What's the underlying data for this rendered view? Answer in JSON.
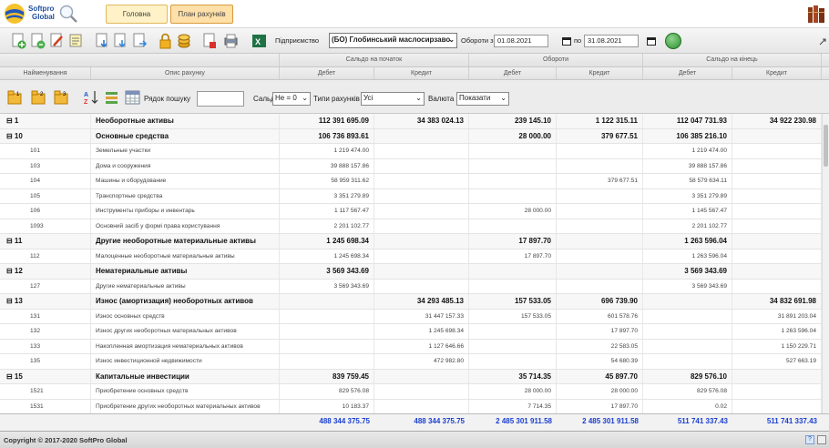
{
  "header": {
    "brand_line1": "Softpro",
    "brand_line2": "Global",
    "tabs": [
      {
        "label": "Головна"
      },
      {
        "label": "План рахунків"
      }
    ]
  },
  "toolbar": {
    "enterprise_label": "Підприємство",
    "enterprise_value": "(БО) Глобинський маслосирзаво",
    "turnover_from_label": "Обороти з",
    "date_from": "01.08.2021",
    "to_label": "по",
    "date_to": "31.08.2021"
  },
  "columns": {
    "group_opening": "Сальдо на початок",
    "group_turnover": "Обороти",
    "group_closing": "Сальдо на кінець",
    "name": "Найменування",
    "description": "Опис рахунку",
    "debit": "Дебет",
    "credit": "Кредит"
  },
  "filters": {
    "search_label": "Рядок пошуку",
    "saldo_label": "Сальдо",
    "saldo_value": "Не = 0",
    "types_label": "Типи рахунків",
    "types_value": "Усі",
    "currency_label": "Валюта",
    "currency_value": "Показати"
  },
  "rows": [
    {
      "code": "⊟ 1",
      "desc": "Необоротные активы",
      "d1": "112 391 695.09",
      "k1": "34 383 024.13",
      "d2": "239 145.10",
      "k2": "1 122 315.11",
      "d3": "112 047 731.93",
      "k3": "34 922 230.98",
      "grp": true
    },
    {
      "code": "⊟ 10",
      "desc": "Основные средства",
      "d1": "106 736 893.61",
      "k1": "",
      "d2": "28 000.00",
      "k2": "379 677.51",
      "d3": "106 385 216.10",
      "k3": "",
      "grp": true
    },
    {
      "code": "101",
      "desc": "Земельные участки",
      "d1": "1 219 474.00",
      "k1": "",
      "d2": "",
      "k2": "",
      "d3": "1 219 474.00",
      "k3": ""
    },
    {
      "code": "103",
      "desc": "Дома и сооружения",
      "d1": "39 888 157.86",
      "k1": "",
      "d2": "",
      "k2": "",
      "d3": "39 888 157.86",
      "k3": ""
    },
    {
      "code": "104",
      "desc": "Машины и оборудование",
      "d1": "58 959 311.62",
      "k1": "",
      "d2": "",
      "k2": "379 677.51",
      "d3": "58 579 634.11",
      "k3": ""
    },
    {
      "code": "105",
      "desc": "Транспортные средства",
      "d1": "3 351 279.89",
      "k1": "",
      "d2": "",
      "k2": "",
      "d3": "3 351 279.89",
      "k3": ""
    },
    {
      "code": "106",
      "desc": "Инструменты приборы и инвентарь",
      "d1": "1 117 567.47",
      "k1": "",
      "d2": "28 000.00",
      "k2": "",
      "d3": "1 145 567.47",
      "k3": ""
    },
    {
      "code": "1093",
      "desc": "Основний засіб у формі права користування",
      "d1": "2 201 102.77",
      "k1": "",
      "d2": "",
      "k2": "",
      "d3": "2 201 102.77",
      "k3": ""
    },
    {
      "code": "⊟ 11",
      "desc": "Другие необоротные материальные активы",
      "d1": "1 245 698.34",
      "k1": "",
      "d2": "17 897.70",
      "k2": "",
      "d3": "1 263 596.04",
      "k3": "",
      "grp": true
    },
    {
      "code": "112",
      "desc": "Малоценные необоротные материальные активы",
      "d1": "1 245 698.34",
      "k1": "",
      "d2": "17 897.70",
      "k2": "",
      "d3": "1 263 596.04",
      "k3": ""
    },
    {
      "code": "⊟ 12",
      "desc": "Нематериальные активы",
      "d1": "3 569 343.69",
      "k1": "",
      "d2": "",
      "k2": "",
      "d3": "3 569 343.69",
      "k3": "",
      "grp": true
    },
    {
      "code": "127",
      "desc": "Другие нематериальные активы",
      "d1": "3 569 343.69",
      "k1": "",
      "d2": "",
      "k2": "",
      "d3": "3 569 343.69",
      "k3": ""
    },
    {
      "code": "⊟ 13",
      "desc": "Износ (амортизация) необоротных активов",
      "d1": "",
      "k1": "34 293 485.13",
      "d2": "157 533.05",
      "k2": "696 739.90",
      "d3": "",
      "k3": "34 832 691.98",
      "grp": true
    },
    {
      "code": "131",
      "desc": "Износ основных средств",
      "d1": "",
      "k1": "31 447 157.33",
      "d2": "157 533.05",
      "k2": "601 578.76",
      "d3": "",
      "k3": "31 891 203.04"
    },
    {
      "code": "132",
      "desc": "Износ других необоротных материальных активов",
      "d1": "",
      "k1": "1 245 698.34",
      "d2": "",
      "k2": "17 897.70",
      "d3": "",
      "k3": "1 263 596.04"
    },
    {
      "code": "133",
      "desc": "Накопленная амортизация нематериальных активов",
      "d1": "",
      "k1": "1 127 646.66",
      "d2": "",
      "k2": "22 583.05",
      "d3": "",
      "k3": "1 150 229.71"
    },
    {
      "code": "135",
      "desc": "Износ инвестиционной недвижимости",
      "d1": "",
      "k1": "472 982.80",
      "d2": "",
      "k2": "54 680.39",
      "d3": "",
      "k3": "527 663.19"
    },
    {
      "code": "⊟ 15",
      "desc": "Капитальные инвестиции",
      "d1": "839 759.45",
      "k1": "",
      "d2": "35 714.35",
      "k2": "45 897.70",
      "d3": "829 576.10",
      "k3": "",
      "grp": true
    },
    {
      "code": "1521",
      "desc": "Приобретение основных средств",
      "d1": "829 576.08",
      "k1": "",
      "d2": "28 000.00",
      "k2": "28 000.00",
      "d3": "829 576.08",
      "k3": ""
    },
    {
      "code": "1531",
      "desc": "Приобретение других необоротных материальных активов",
      "d1": "10 183.37",
      "k1": "",
      "d2": "7 714.35",
      "k2": "17 897.70",
      "d3": "0.02",
      "k3": ""
    }
  ],
  "totals": {
    "d1": "488 344 375.75",
    "k1": "488 344 375.75",
    "d2": "2 485 301 911.58",
    "k2": "2 485 301 911.58",
    "d3": "511 741 337.43",
    "k3": "511 741 337.43"
  },
  "footer": {
    "copyright": "Copyright © 2017-2020 SoftPro Global",
    "help": "?"
  },
  "colors": {
    "totals_text": "#1a3fd0",
    "tab_active": "#ffe0a8",
    "brand": "#1f4e9c"
  }
}
